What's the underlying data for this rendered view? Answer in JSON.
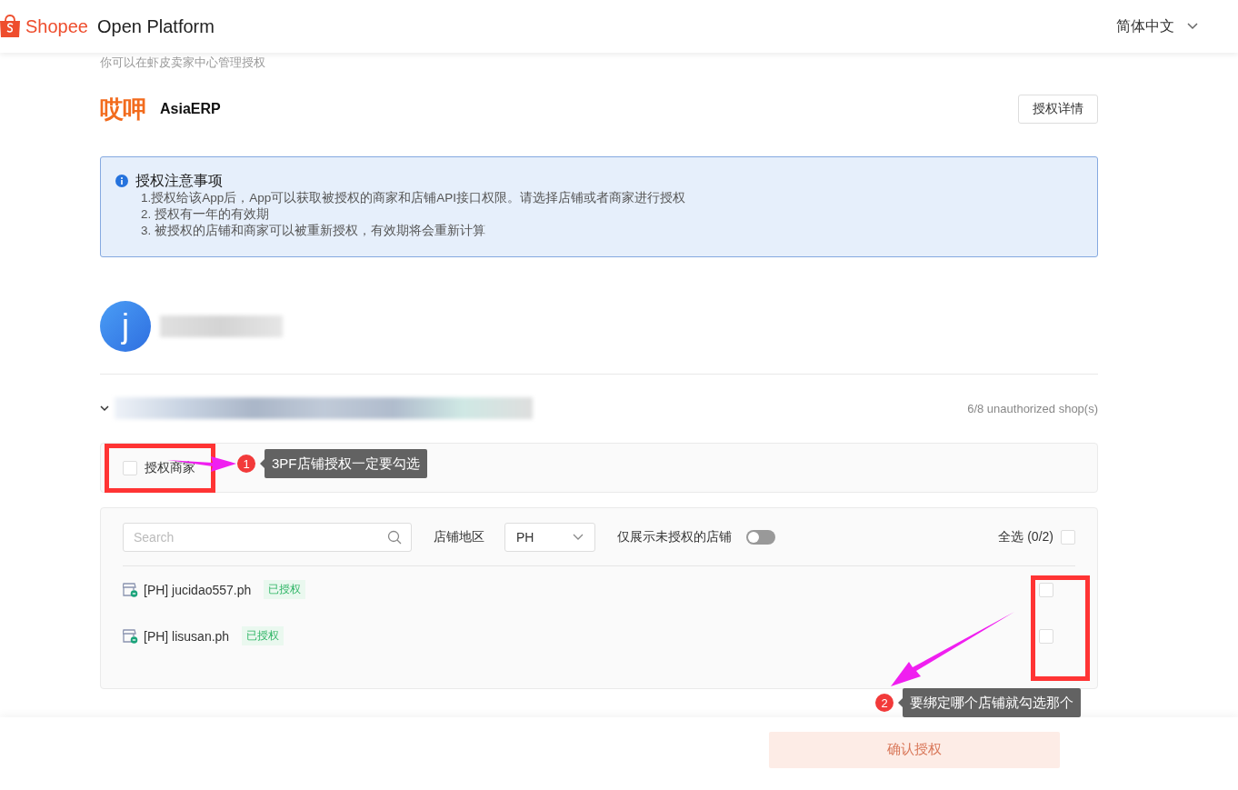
{
  "header": {
    "brand": "Shopee",
    "product": "Open Platform",
    "language": "简体中文"
  },
  "subtitle": "你可以在虾皮卖家中心管理授权",
  "app": {
    "logo": "哎呷",
    "name": "AsiaERP",
    "details_button": "授权详情"
  },
  "notice": {
    "title": "授权注意事项",
    "lines": [
      "1.授权给该App后，App可以获取被授权的商家和店铺API接口权限。请选择店铺或者商家进行授权",
      "2. 授权有一年的有效期",
      "3. 被授权的店铺和商家可以被重新授权，有效期将会重新计算"
    ]
  },
  "account": {
    "avatar_letter": "j"
  },
  "shop_group": {
    "expanded": true,
    "unauthorized_count": "6/8 unauthorized shop(s)"
  },
  "merchant": {
    "label": "授权商家",
    "checked": false
  },
  "filters": {
    "search": {
      "placeholder": "Search"
    },
    "region_label": "店铺地区",
    "region": "PH",
    "unauthorized_only_label": "仅展示未授权的店铺",
    "unauthorized_only_on": false,
    "select_all": "全选 (0/2)",
    "select_all_checked": false
  },
  "shops": [
    {
      "name": "[PH] jucidao557.ph",
      "status": "已授权",
      "checked": false
    },
    {
      "name": "[PH] lisusan.ph",
      "status": "已授权",
      "checked": false
    }
  ],
  "confirm_button": {
    "label": "确认授权",
    "disabled": true
  },
  "annotations": [
    {
      "number": "1",
      "text": "3PF店铺授权一定要勾选"
    },
    {
      "number": "2",
      "text": "要绑定哪个店铺就勾选那个"
    }
  ]
}
